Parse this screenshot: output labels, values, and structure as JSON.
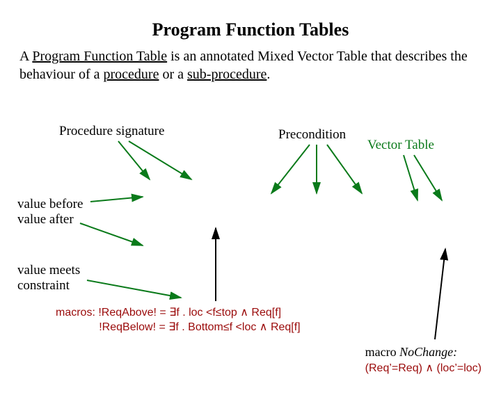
{
  "title": "Program Function Tables",
  "intro": {
    "pre1": "A ",
    "u1": "Program Function Table",
    "mid1": " is an annotated Mixed Vector Table that describes the behaviour of a ",
    "u2": "procedure",
    "mid2": " or a ",
    "u3": "sub-procedure",
    "end": "."
  },
  "labels": {
    "procsig": "Procedure signature",
    "precond": "Precondition",
    "vectortable": "Vector Table",
    "before": "value before",
    "after": "value after",
    "meets": "value meets\nconstraint"
  },
  "macros": {
    "prefix": "macros:",
    "line1": "!ReqAbove! = ∃f . loc <f≤top ∧ Req[f]",
    "line2": "!ReqBelow! = ∃f . Bottom≤f <loc ∧ Req[f]"
  },
  "nochange": {
    "label": "macro",
    "name": "NoChange:",
    "eq": "(Req’=Req) ∧ (loc’=loc)"
  }
}
